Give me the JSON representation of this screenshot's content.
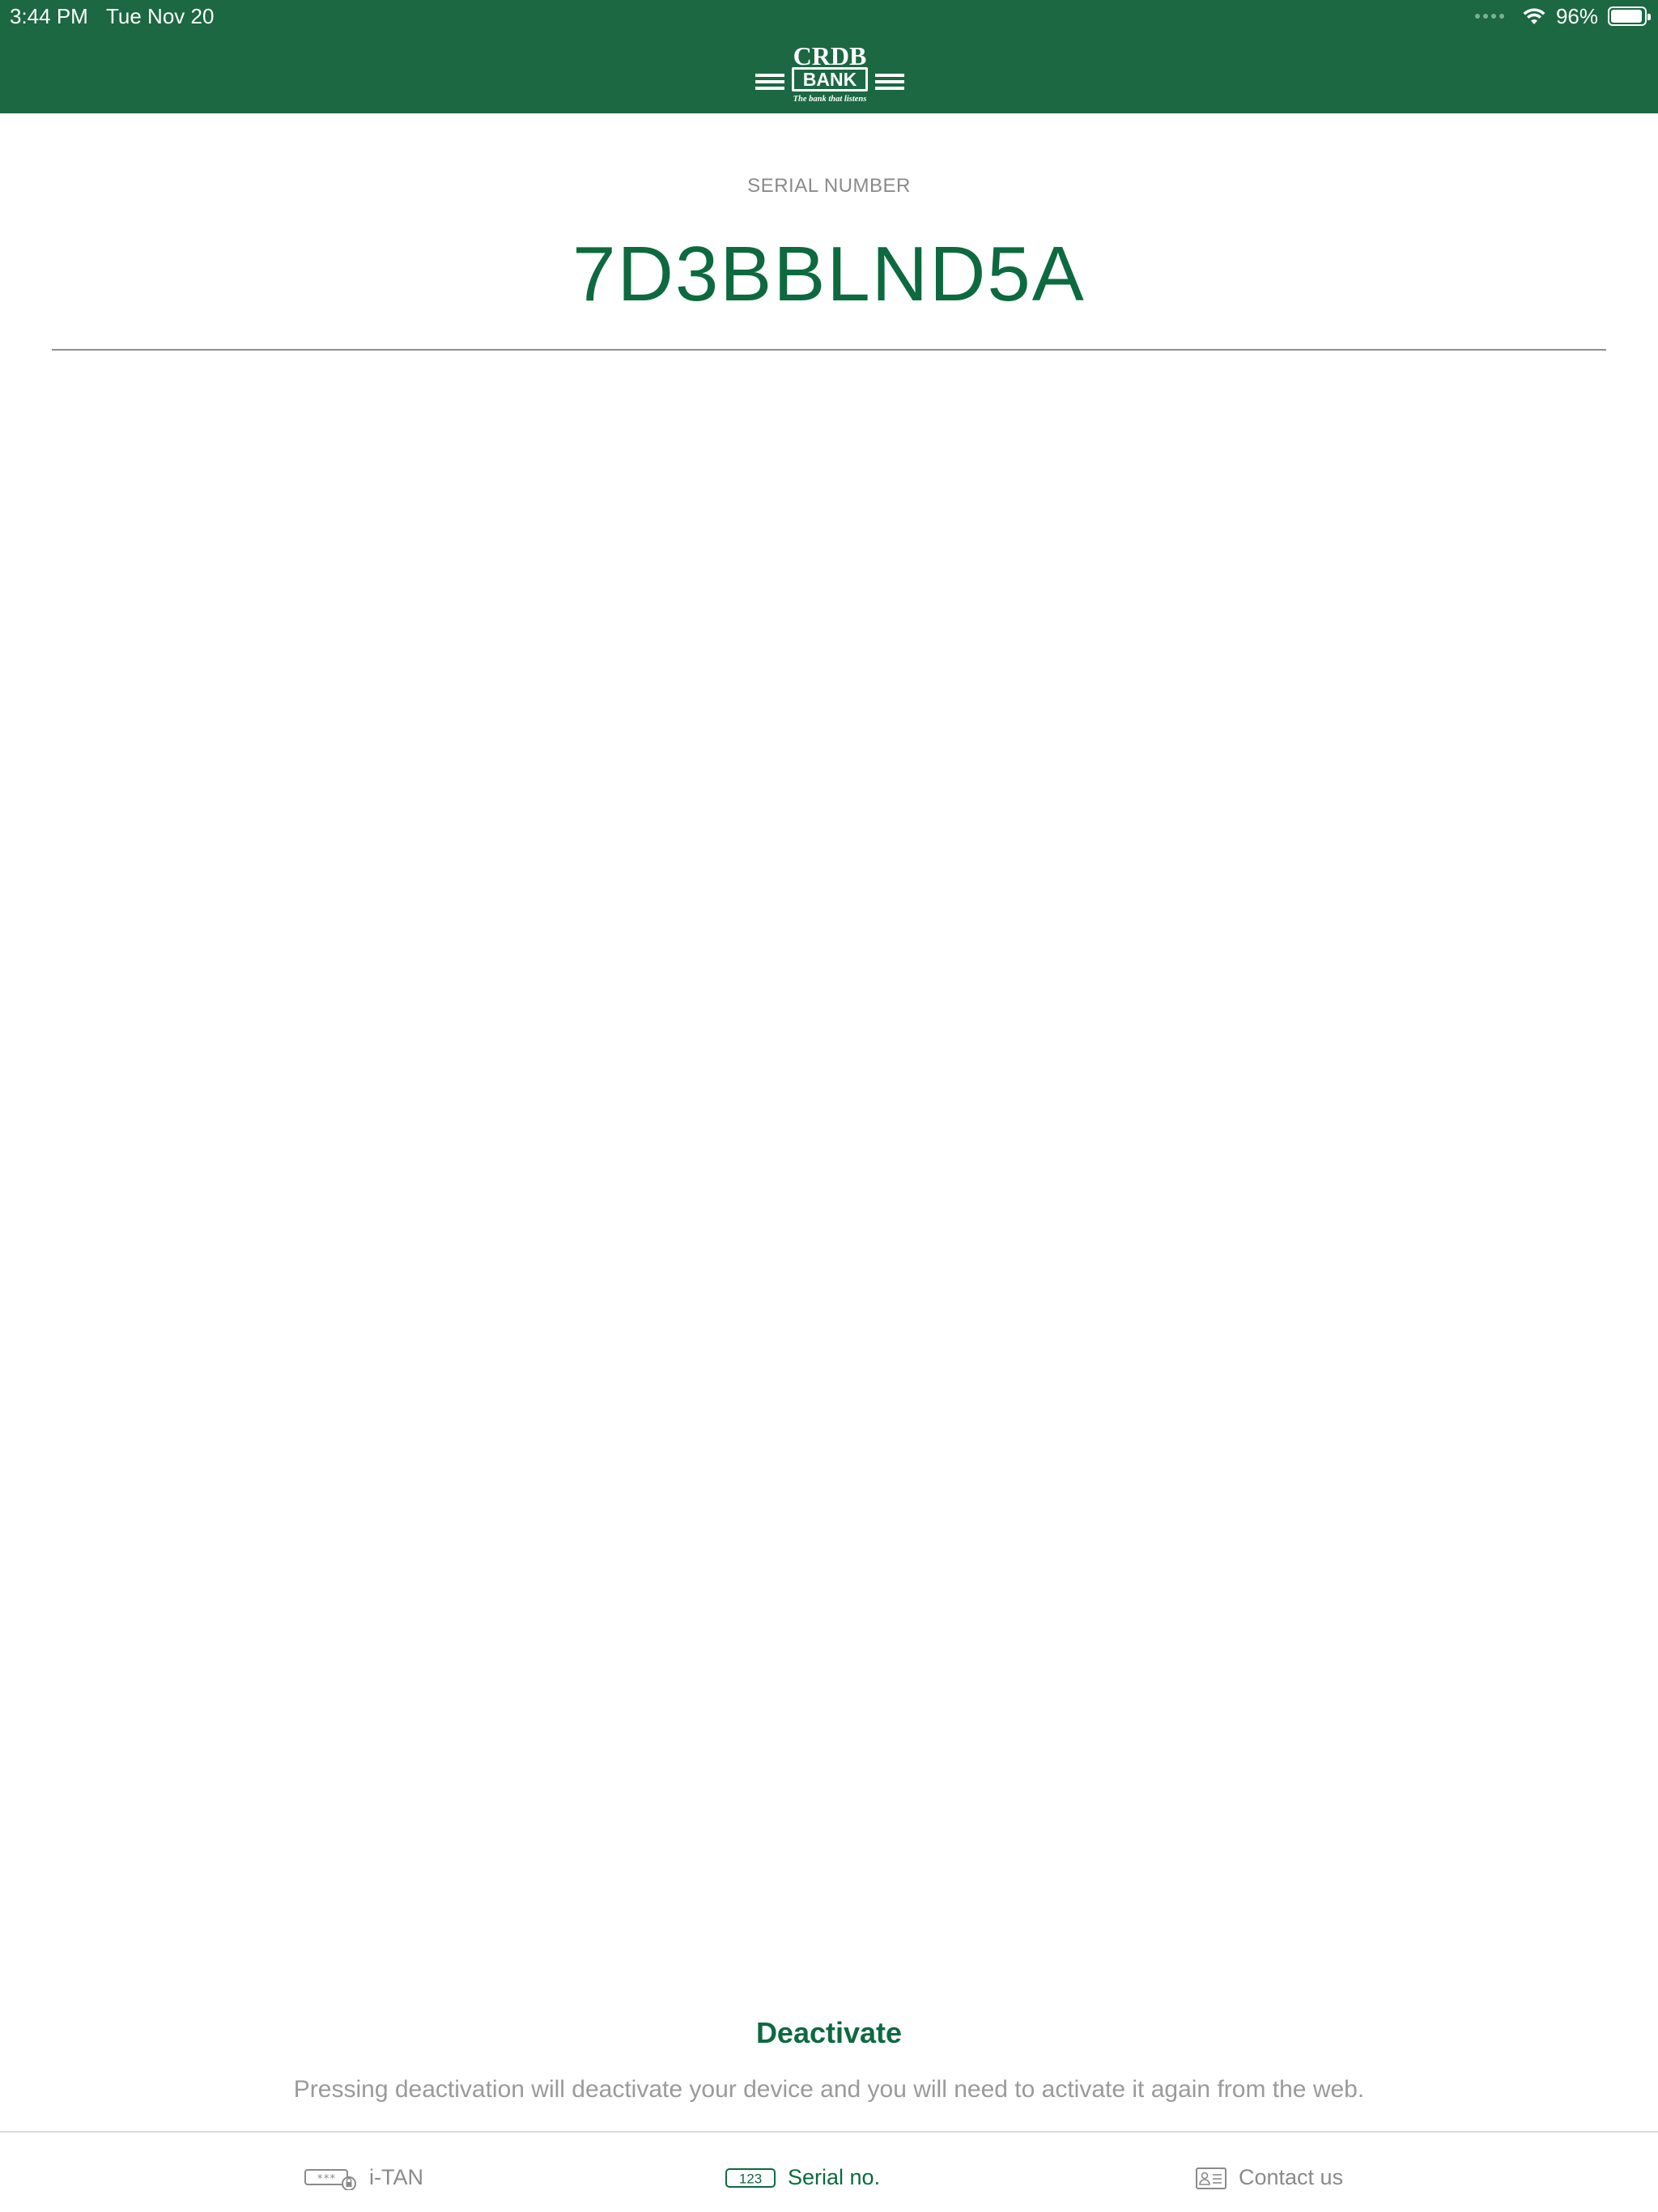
{
  "status_bar": {
    "time": "3:44 PM",
    "date": "Tue Nov 20",
    "battery": "96%",
    "battery_level": 0.96
  },
  "header": {
    "logo_text": "CRDB",
    "logo_bank": "BANK",
    "logo_tagline": "The bank that listens",
    "background_color": "#1b6842"
  },
  "serial": {
    "label": "SERIAL NUMBER",
    "value": "7D3BBLND5A",
    "accent_color": "#0d6a3f"
  },
  "deactivate": {
    "button_label": "Deactivate",
    "note": "Pressing deactivation will deactivate your device and you will need to activate it again from the web."
  },
  "tabbar": {
    "tabs": [
      {
        "label": "i-TAN",
        "icon": "itan-icon",
        "active": false
      },
      {
        "label": "Serial no.",
        "icon": "serial-number-icon",
        "icon_text": "123",
        "active": true
      },
      {
        "label": "Contact us",
        "icon": "contact-card-icon",
        "active": false
      }
    ]
  }
}
